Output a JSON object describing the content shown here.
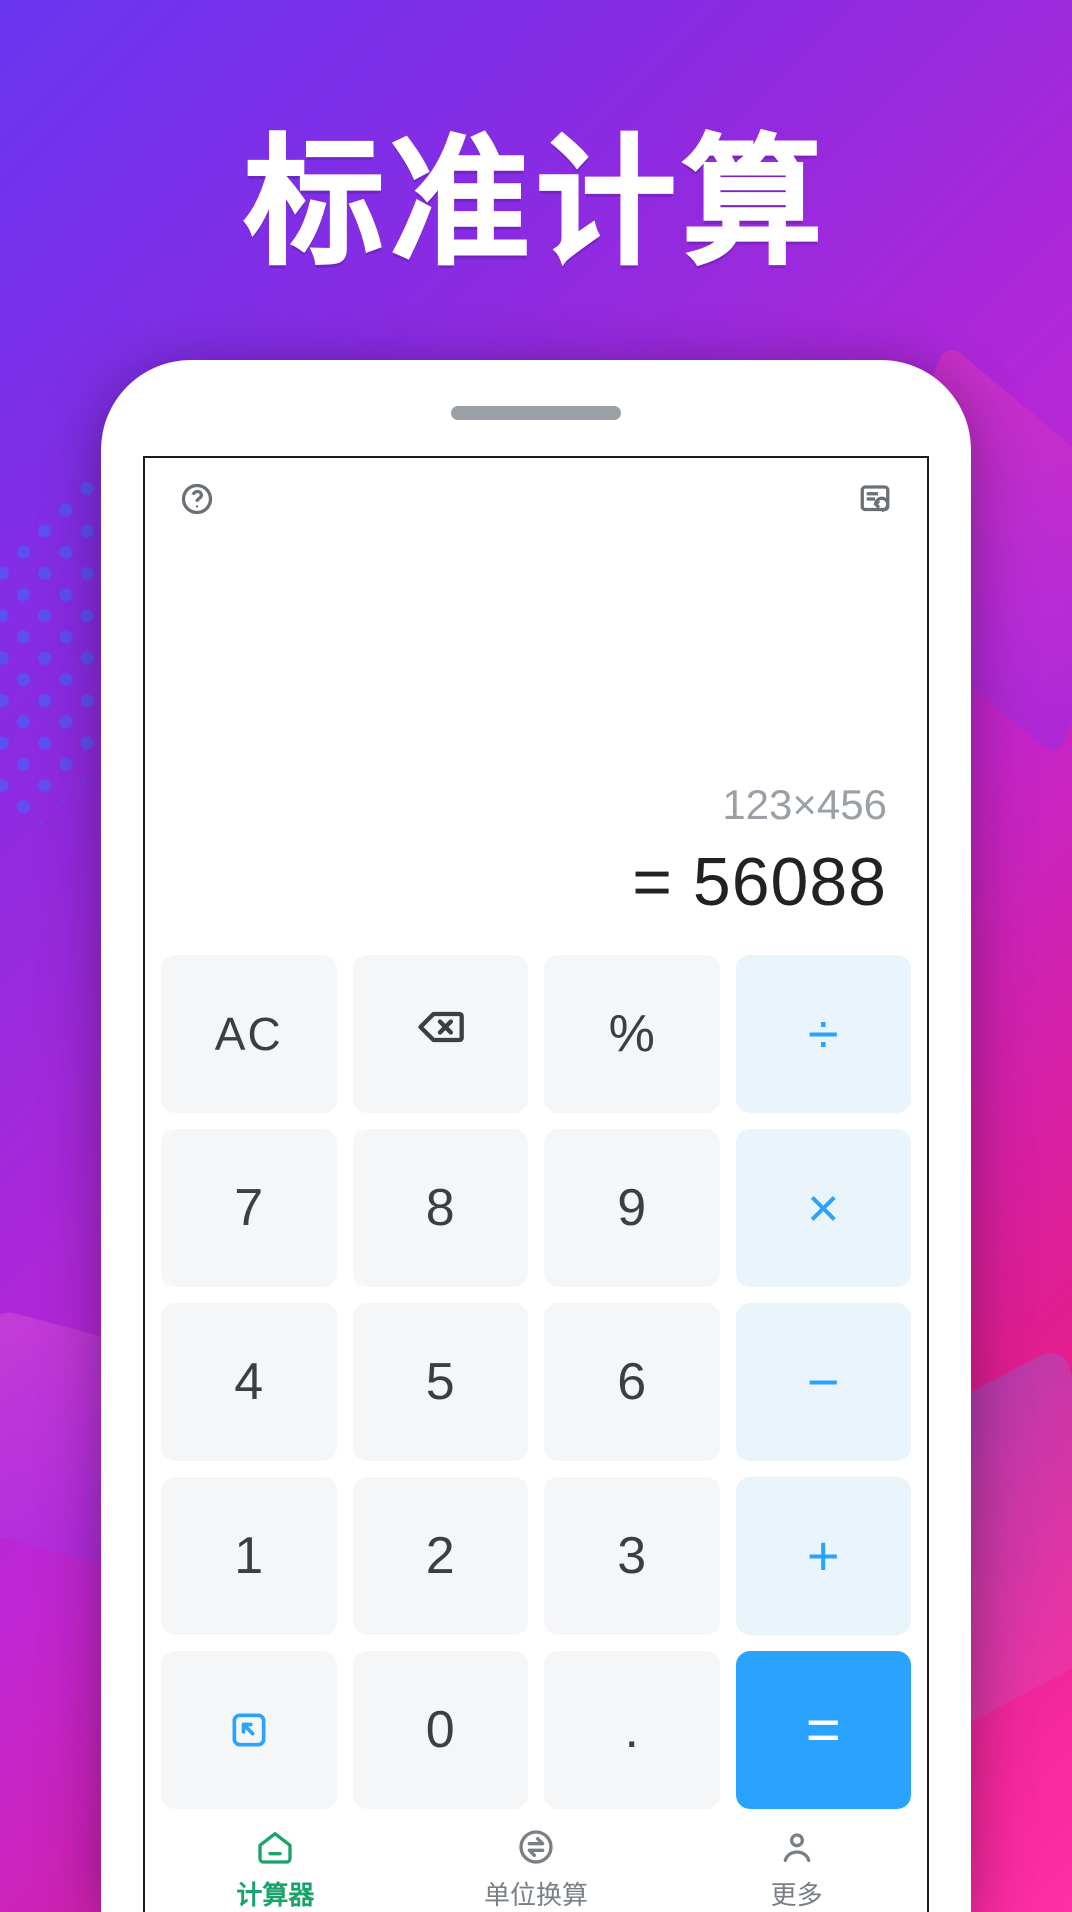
{
  "headline": "标准计算",
  "display": {
    "expression": "123×456",
    "result": "= 56088"
  },
  "keys": {
    "ac": "AC",
    "percent": "%",
    "divide": "÷",
    "k7": "7",
    "k8": "8",
    "k9": "9",
    "multiply": "×",
    "k4": "4",
    "k5": "5",
    "k6": "6",
    "minus": "−",
    "k1": "1",
    "k2": "2",
    "k3": "3",
    "plus": "+",
    "k0": "0",
    "dot": ".",
    "equals": "="
  },
  "nav": {
    "calculator": "计算器",
    "unit": "单位换算",
    "more": "更多"
  }
}
